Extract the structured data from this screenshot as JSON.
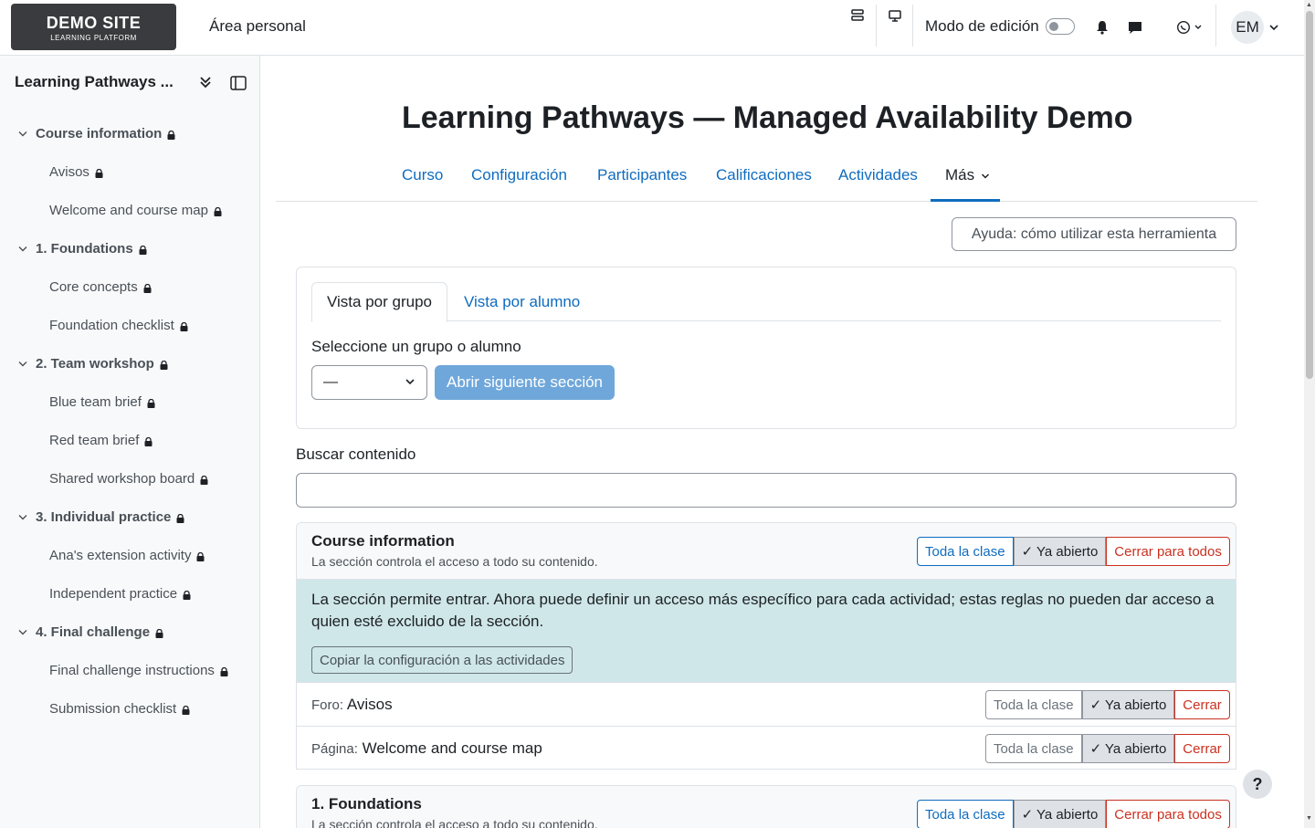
{
  "brand": {
    "line1": "DEMO SITE",
    "line2": "LEARNING PLATFORM"
  },
  "nav": {
    "home_label": "Área personal",
    "edit_mode_label": "Modo de edición",
    "avatar_initials": "EM"
  },
  "sidebar": {
    "title": "Learning Pathways ...",
    "items": [
      {
        "label": "Course information",
        "type": "section"
      },
      {
        "label": "Avisos",
        "type": "activity"
      },
      {
        "label": "Welcome and course map",
        "type": "activity"
      },
      {
        "label": "1. Foundations",
        "type": "section"
      },
      {
        "label": "Core concepts",
        "type": "activity"
      },
      {
        "label": "Foundation checklist",
        "type": "activity"
      },
      {
        "label": "2. Team workshop",
        "type": "section"
      },
      {
        "label": "Blue team brief",
        "type": "activity"
      },
      {
        "label": "Red team brief",
        "type": "activity"
      },
      {
        "label": "Shared workshop board",
        "type": "activity"
      },
      {
        "label": "3. Individual practice",
        "type": "section"
      },
      {
        "label": "Ana's extension activity",
        "type": "activity"
      },
      {
        "label": "Independent practice",
        "type": "activity"
      },
      {
        "label": "4. Final challenge",
        "type": "section"
      },
      {
        "label": "Final challenge instructions",
        "type": "activity"
      },
      {
        "label": "Submission checklist",
        "type": "activity"
      }
    ]
  },
  "page": {
    "title": "Learning Pathways — Managed Availability Demo",
    "tabs": [
      "Curso",
      "Configuración",
      "Participantes",
      "Calificaciones",
      "Actividades",
      "Más"
    ],
    "help_button": "Ayuda: cómo utilizar esta herramienta"
  },
  "selector_card": {
    "tab_group": "Vista por grupo",
    "tab_student": "Vista por alumno",
    "select_label": "Seleccione un grupo o alumno",
    "select_value": "—",
    "open_next_button": "Abrir siguiente sección"
  },
  "search": {
    "label": "Buscar contenido",
    "placeholder": ""
  },
  "buttons": {
    "whole_class": "Toda la clase",
    "already_open": "✓ Ya abierto",
    "close_all": "Cerrar para todos",
    "close": "Cerrar"
  },
  "sections": [
    {
      "name": "Course information",
      "desc": "La sección controla el acceso a todo su contenido.",
      "info": "La sección permite entrar. Ahora puede definir un acceso más específico para cada actividad; estas reglas no pueden dar acceso a quien esté excluido de la sección.",
      "copy_button": "Copiar la configuración a las actividades",
      "activities": [
        {
          "type": "Foro:",
          "name": "Avisos"
        },
        {
          "type": "Página:",
          "name": "Welcome and course map"
        }
      ]
    },
    {
      "name": "1. Foundations",
      "desc": "La sección controla el acceso a todo su contenido."
    }
  ],
  "help_fab": "?"
}
